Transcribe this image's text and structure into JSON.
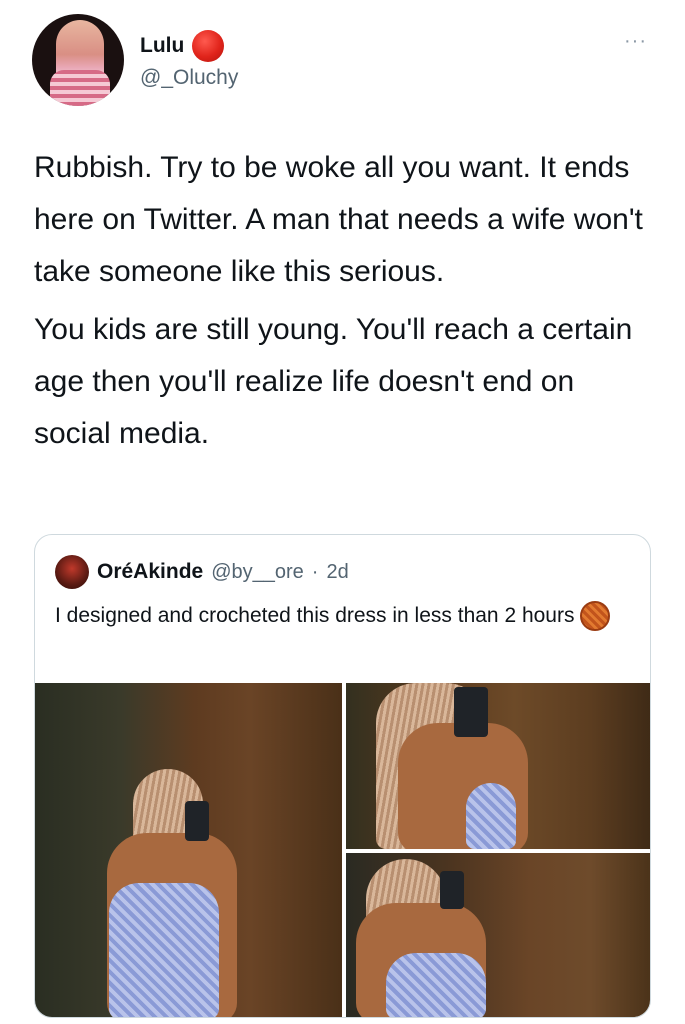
{
  "author": {
    "display_name": "Lulu",
    "handle": "@_Oluchy"
  },
  "more_glyph": "···",
  "tweet": {
    "paragraphs": [
      "Rubbish. Try to be woke all you want. It ends here on Twitter. A man that needs a wife won't take someone like this serious.",
      "You kids are still young. You'll reach a certain age then you'll realize life doesn't end on social media."
    ]
  },
  "quoted": {
    "display_name": "OréAkinde",
    "handle": "@by__ore",
    "separator": "·",
    "time": "2d",
    "text": "I designed and crocheted this dress in less than 2 hours",
    "emoji_icon": "yarn-icon",
    "photo_count": 3
  },
  "colors": {
    "text": "#0f1419",
    "secondary": "#536471",
    "border": "#cfd9de",
    "badge": "#e0241b"
  }
}
